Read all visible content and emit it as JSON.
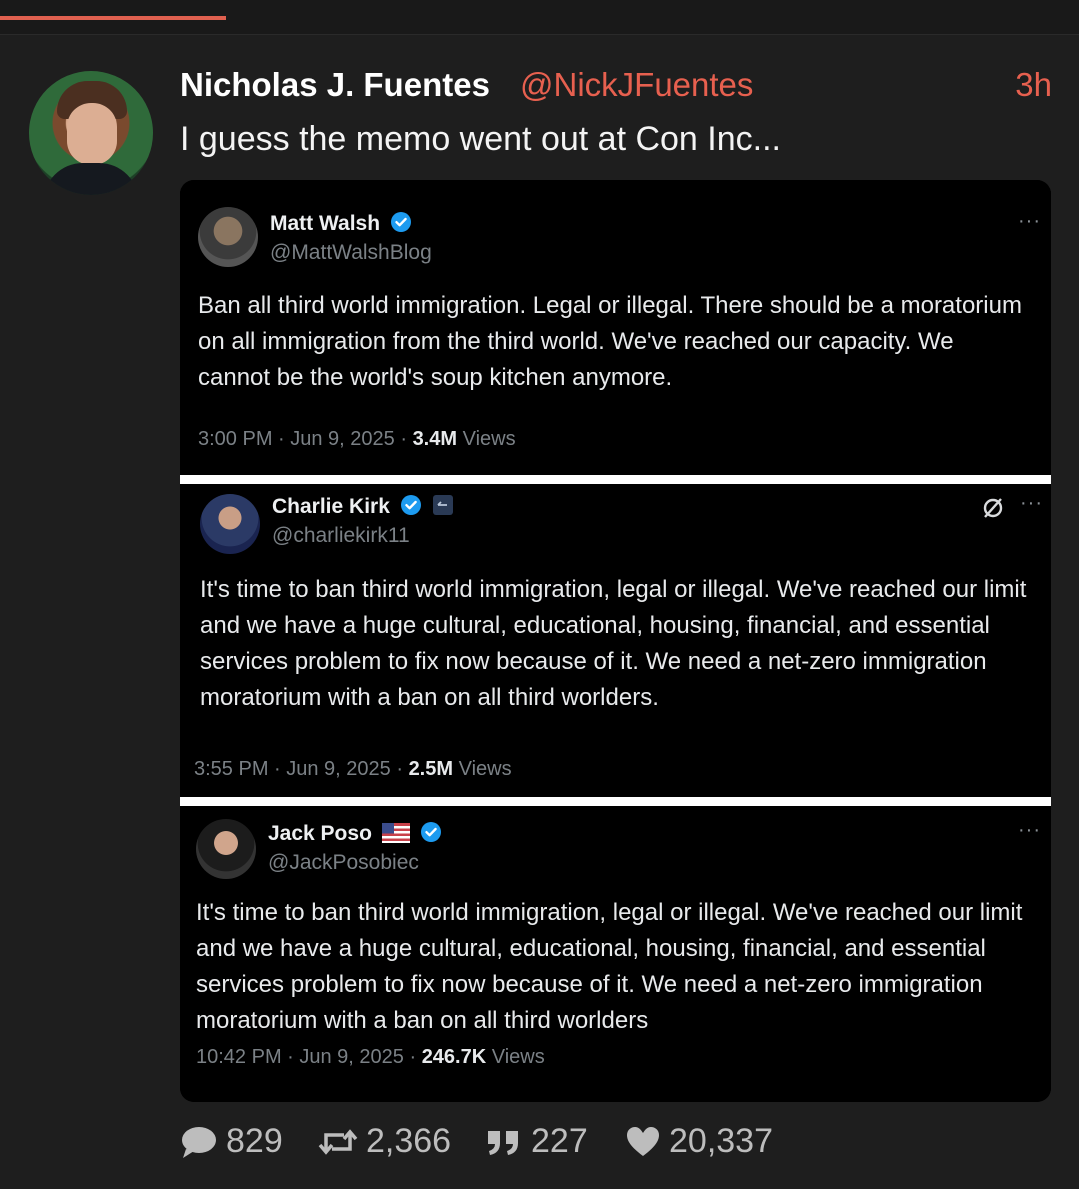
{
  "post": {
    "author_name": "Nicholas J. Fuentes",
    "author_handle": "@NickJFuentes",
    "time": "3h",
    "text": "I guess the memo went out at Con Inc..."
  },
  "embedded": [
    {
      "name": "Matt Walsh",
      "handle": "@MattWalshBlog",
      "body": "Ban all third world immigration. Legal or illegal. There should be a moratorium on all immigration from the third world. We've reached our capacity. We cannot be the world's soup kitchen anymore.",
      "timestamp": "3:00 PM · Jun 9, 2025 · ",
      "views_count": "3.4M",
      "views_label": " Views",
      "more": "···"
    },
    {
      "name": "Charlie Kirk",
      "handle": "@charliekirk11",
      "body": "It's time to ban third world immigration, legal or illegal. We've reached our limit and we have a huge cultural, educational, housing, financial, and essential services problem to fix now because of it. We need a net-zero immigration moratorium with a ban on all third worlders.",
      "timestamp": "3:55 PM · Jun 9, 2025 · ",
      "views_count": "2.5M",
      "views_label": " Views",
      "more": "···"
    },
    {
      "name": "Jack Poso",
      "handle": "@JackPosobiec",
      "body": "It's time to ban third world immigration, legal or illegal. We've reached our limit and we have a huge cultural, educational, housing, financial, and essential services problem to fix now because of it. We need a net-zero immigration moratorium with a ban on all third worlders",
      "timestamp": "10:42 PM · Jun 9, 2025 · ",
      "views_count": "246.7K",
      "views_label": " Views",
      "more": "···"
    }
  ],
  "actions": {
    "replies": "829",
    "reposts": "2,366",
    "quotes": "227",
    "likes": "20,337"
  },
  "colors": {
    "accent": "#e7604f",
    "background": "#1e1e1e",
    "verified": "#1d9bf0"
  }
}
